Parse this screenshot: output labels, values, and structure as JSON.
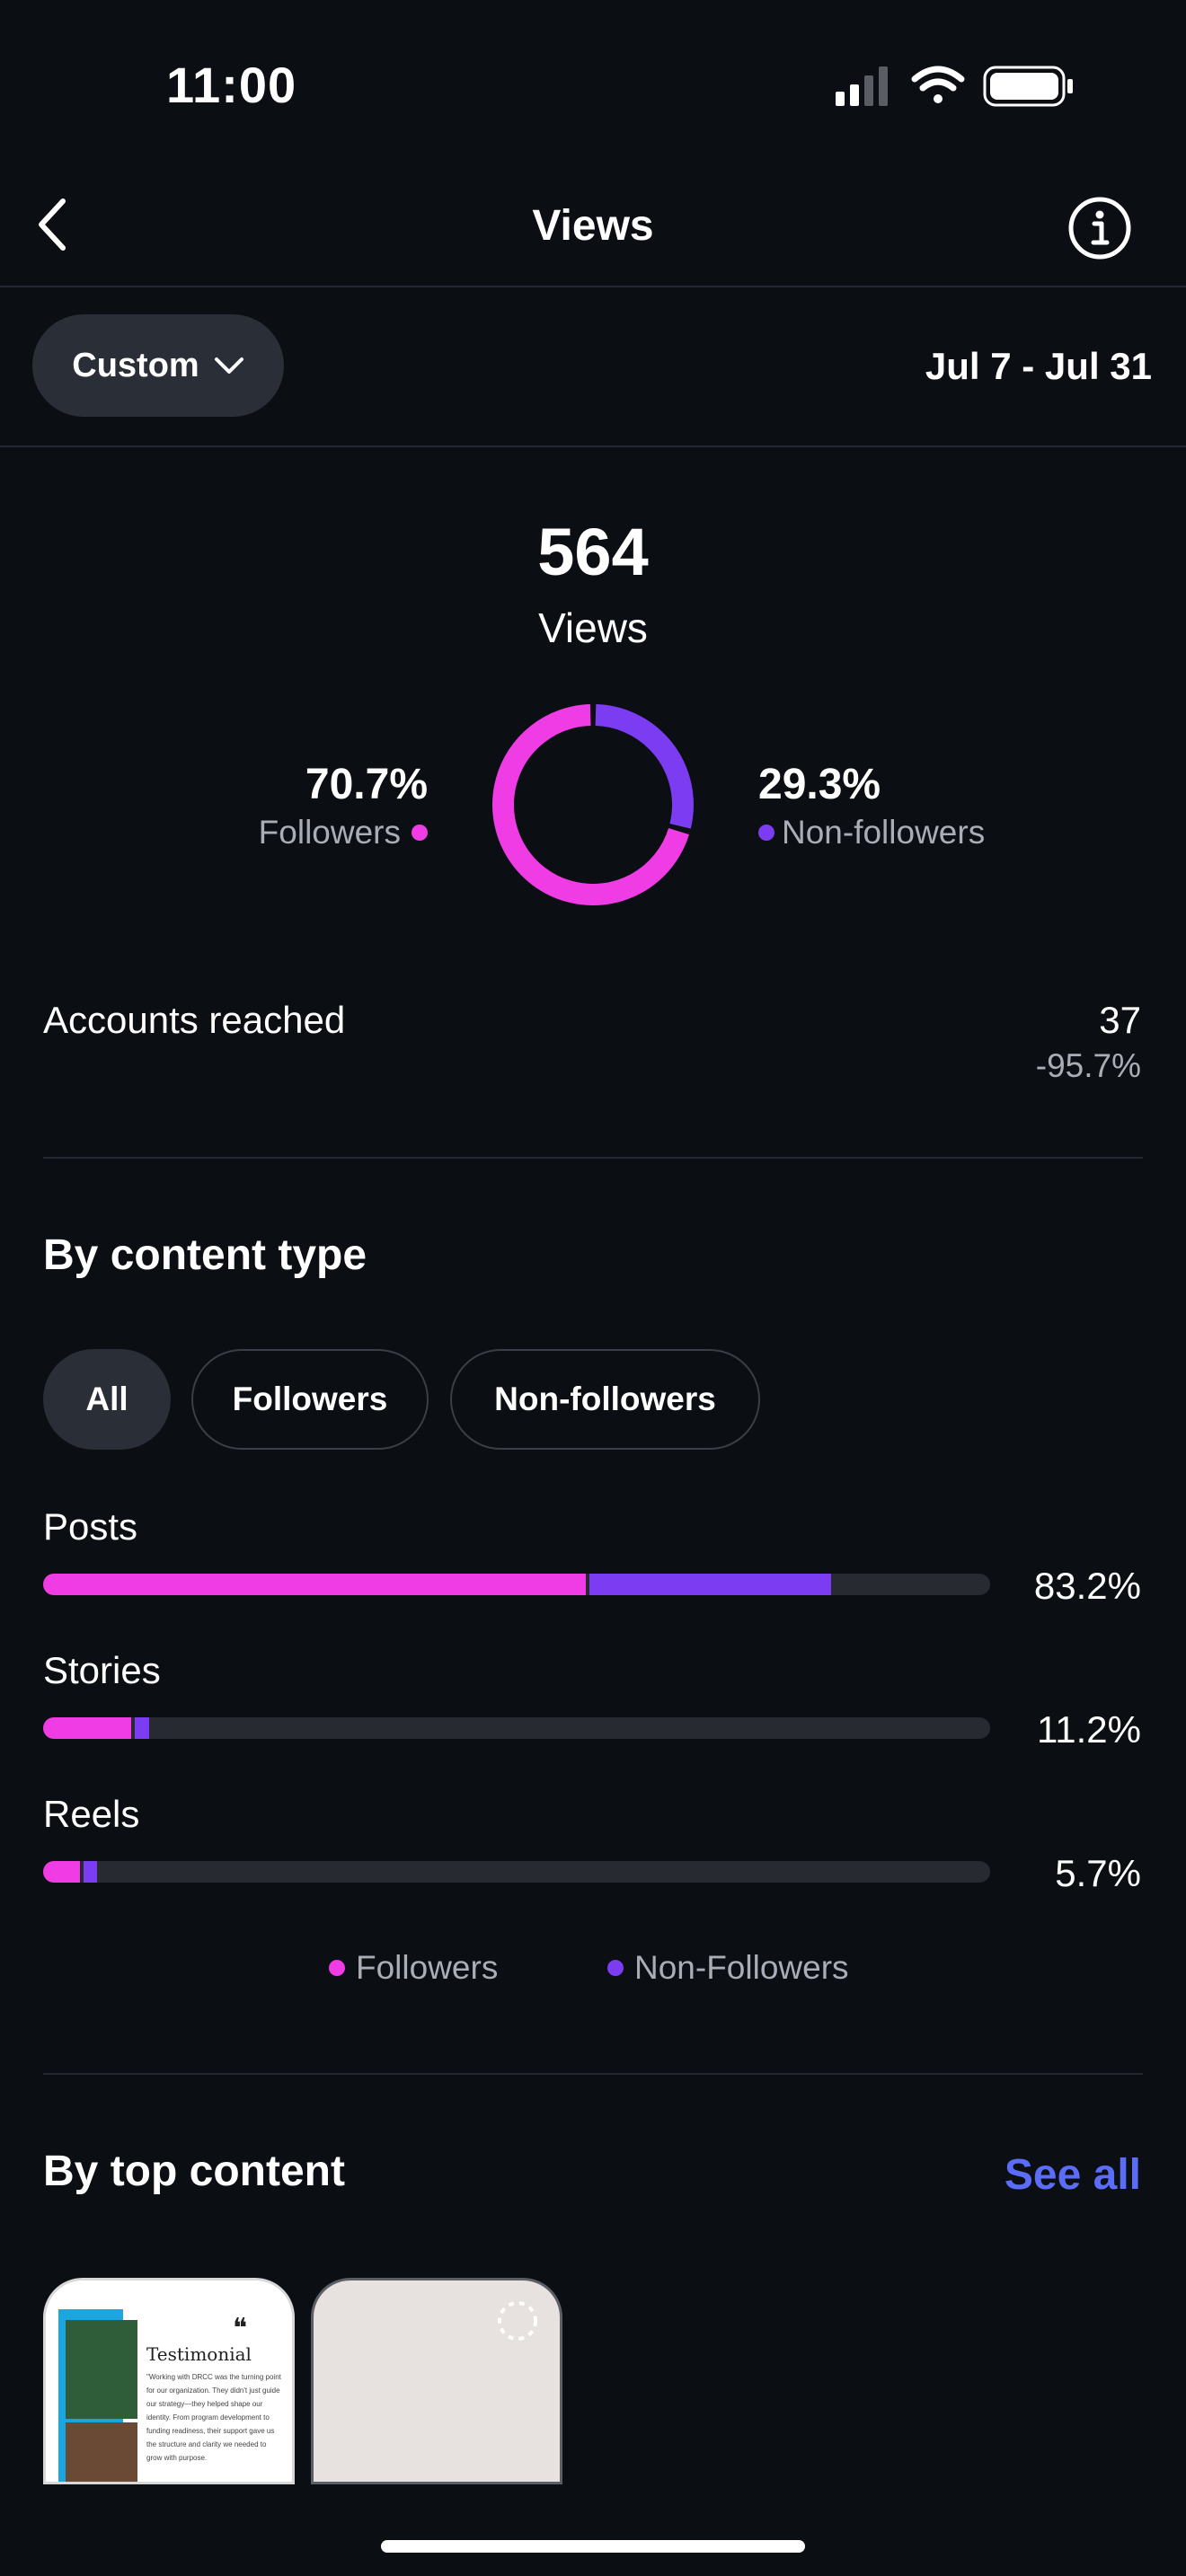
{
  "status_bar": {
    "time": "11:00",
    "icons": [
      "cellular-signal-icon",
      "wifi-icon",
      "battery-icon"
    ]
  },
  "nav": {
    "title": "Views",
    "back_icon": "chevron-left-icon",
    "info_icon": "info-icon"
  },
  "filter": {
    "period_label": "Custom",
    "date_range": "Jul 7 - Jul 31"
  },
  "summary": {
    "total": "564",
    "total_label": "Views",
    "followers_pct": "70.7%",
    "followers_label": "Followers",
    "nonfollowers_pct": "29.3%",
    "nonfollowers_label": "Non-followers",
    "followers_fraction": 0.707,
    "nonfollowers_fraction": 0.293
  },
  "accounts_reached": {
    "label": "Accounts reached",
    "value": "37",
    "change": "-95.7%"
  },
  "content_type": {
    "title": "By content type",
    "tabs": [
      "All",
      "Followers",
      "Non-followers"
    ],
    "active_tab": 0,
    "rows": [
      {
        "label": "Posts",
        "pct": "83.2%",
        "followers_share": 0.573,
        "nonfollowers_share": 0.259
      },
      {
        "label": "Stories",
        "pct": "11.2%",
        "followers_share": 0.093,
        "nonfollowers_share": 0.019
      },
      {
        "label": "Reels",
        "pct": "5.7%",
        "followers_share": 0.039,
        "nonfollowers_share": 0.018
      }
    ],
    "legend": {
      "followers": "Followers",
      "nonfollowers": "Non-Followers"
    }
  },
  "top_content": {
    "title": "By top content",
    "see_all": "See all",
    "thumb1": {
      "heading": "Testimonial",
      "quote": "\"Working with DRCC was the turning point for our organization. They didn't just guide our strategy—they helped shape our identity. From program development to funding readiness, their support gave us the structure and clarity we needed to grow with purpose."
    }
  },
  "colors": {
    "followers": "#f03ce4",
    "nonfollowers": "#7c3cf2",
    "link": "#5b6cf6",
    "background": "#0b0e13"
  }
}
